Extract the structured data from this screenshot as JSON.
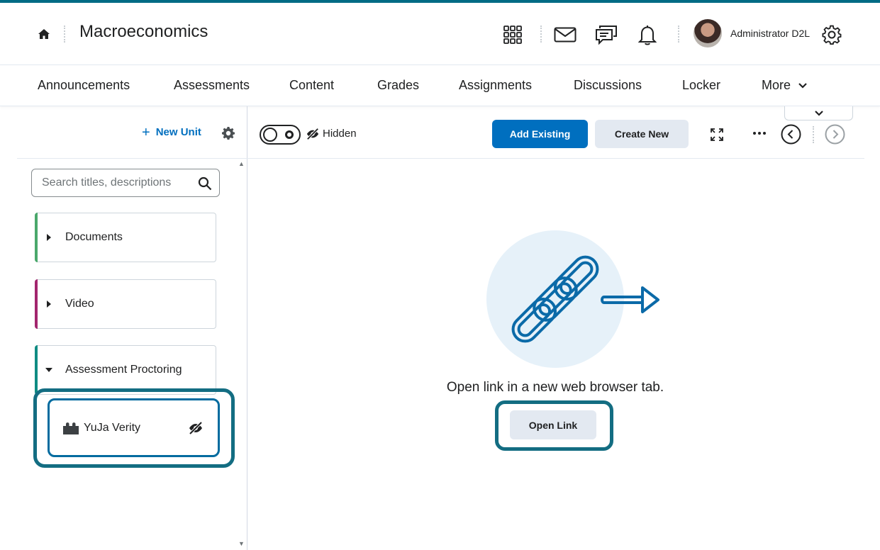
{
  "header": {
    "course_title": "Macroeconomics",
    "user_name": "Administrator D2L",
    "icons": [
      "home-icon",
      "waffle-icon",
      "mail-icon",
      "chat-icon",
      "bell-icon",
      "gear-icon"
    ]
  },
  "nav": {
    "items": [
      "Announcements",
      "Assessments",
      "Content",
      "Grades",
      "Assignments",
      "Discussions",
      "Locker"
    ],
    "more_label": "More"
  },
  "sidebar": {
    "new_unit_label": "New Unit",
    "search_placeholder": "Search titles, descriptions",
    "units": [
      {
        "label": "Documents",
        "color": "#4aa86b",
        "expanded": false
      },
      {
        "label": "Video",
        "color": "#a3266e",
        "expanded": false
      },
      {
        "label": "Assessment Proctoring",
        "color": "#0f8c83",
        "expanded": true
      }
    ],
    "topic": {
      "label": "YuJa Verity",
      "hidden": true
    }
  },
  "toolbar": {
    "hidden_label": "Hidden",
    "add_existing_label": "Add Existing",
    "create_new_label": "Create New"
  },
  "content": {
    "message": "Open link in a new web browser tab.",
    "open_link_label": "Open Link"
  },
  "colors": {
    "accent": "#006fbf",
    "highlight": "#136d82",
    "top_stripe": "#006b85"
  }
}
